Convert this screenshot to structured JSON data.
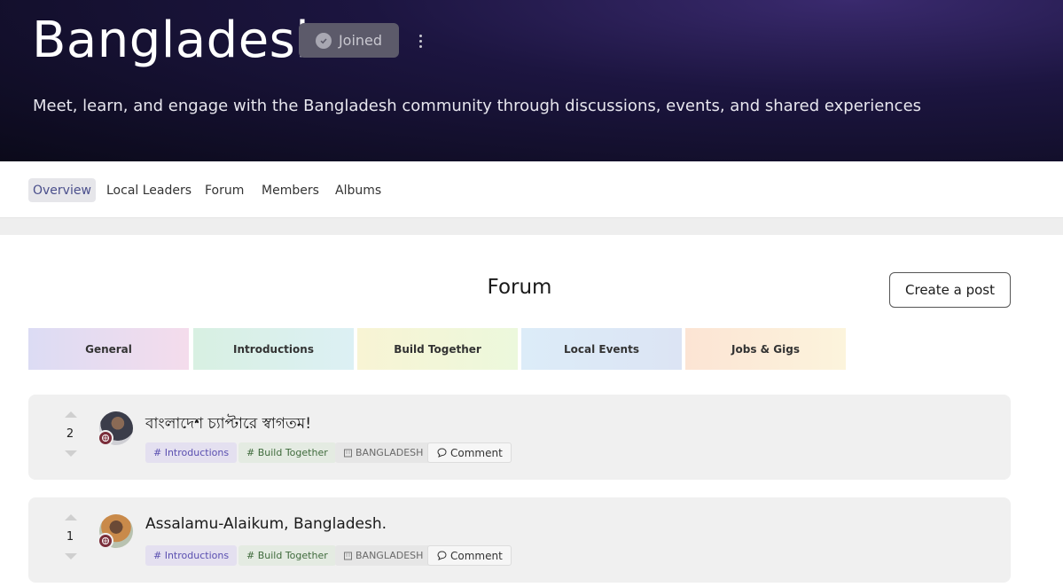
{
  "hero": {
    "title": "Bangladesh",
    "joined_label": "Joined",
    "subtitle": "Meet, learn, and engage with the Bangladesh community through discussions, events, and shared experiences"
  },
  "tabs": [
    {
      "label": "Overview",
      "active": true
    },
    {
      "label": "Local Leaders",
      "active": false
    },
    {
      "label": "Forum",
      "active": false
    },
    {
      "label": "Members",
      "active": false
    },
    {
      "label": "Albums",
      "active": false
    }
  ],
  "forum": {
    "title": "Forum",
    "create_label": "Create a post",
    "categories": [
      {
        "label": "General",
        "gradient": [
          "#dcdcf4",
          "#f4dcec"
        ]
      },
      {
        "label": "Introductions",
        "gradient": [
          "#d8f0e2",
          "#dcf0f4"
        ]
      },
      {
        "label": "Build Together",
        "gradient": [
          "#f8f4d4",
          "#ecf8dc"
        ]
      },
      {
        "label": "Local Events",
        "gradient": [
          "#dcecf8",
          "#dce4f4"
        ]
      },
      {
        "label": "Jobs & Gigs",
        "gradient": [
          "#fce4d4",
          "#fcf4dc"
        ]
      }
    ]
  },
  "posts": [
    {
      "votes": "2",
      "title": "বাংলাদেশ চ্যাপ্টারে স্বাগতম!",
      "tag1": "# Introductions",
      "tag2": "# Build Together",
      "location": "BANGLADESH",
      "comment_label": "Comment"
    },
    {
      "votes": "1",
      "title": "Assalamu-Alaikum, Bangladesh.",
      "tag1": "# Introductions",
      "tag2": "# Build Together",
      "location": "BANGLADESH",
      "comment_label": "Comment"
    }
  ],
  "colors": {
    "hero_bg": "#0b0a1a",
    "accent": "#4a4f8c"
  }
}
